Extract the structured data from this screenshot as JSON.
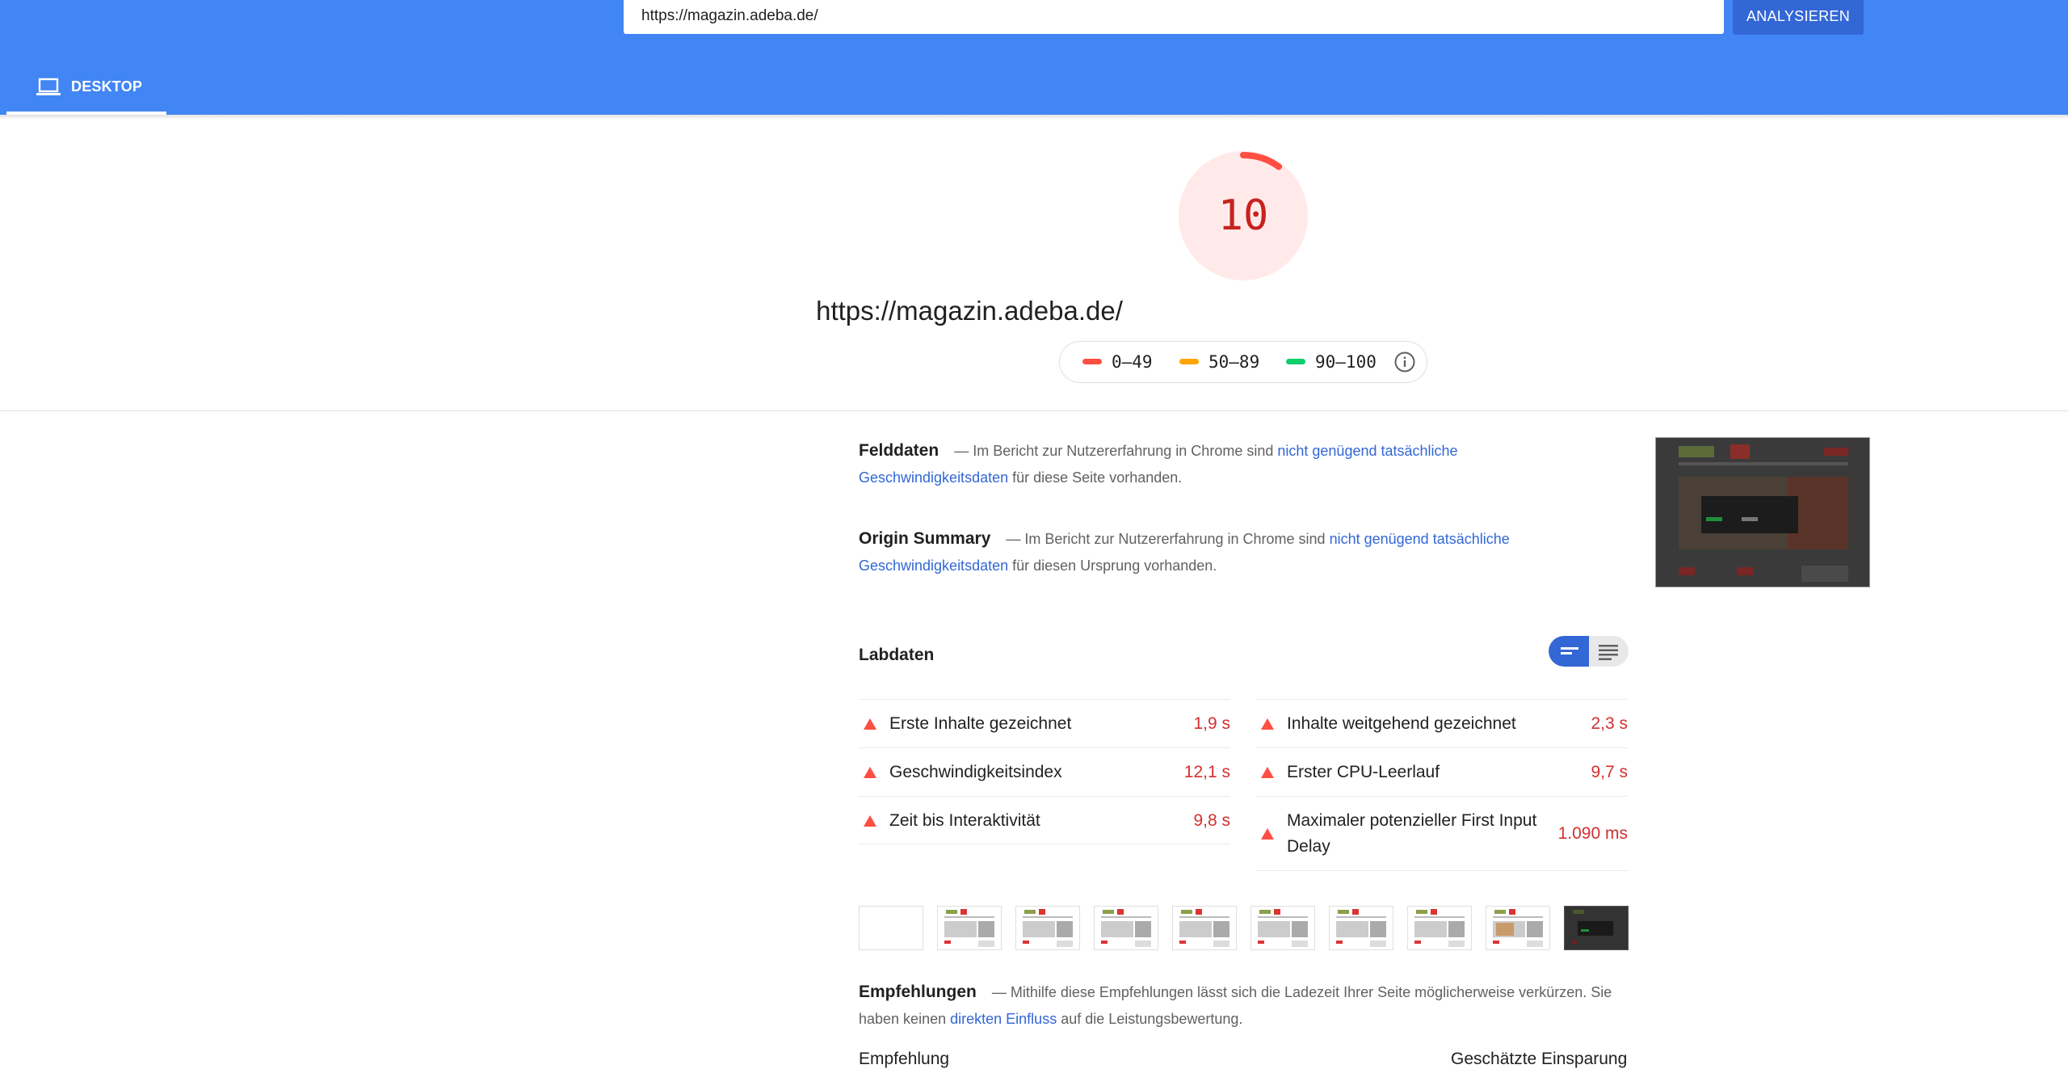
{
  "header": {
    "url_value": "https://magazin.adeba.de/",
    "analyze_label": "ANALYSIEREN",
    "tab_desktop": "DESKTOP"
  },
  "score": {
    "value": "10",
    "fraction": 0.1,
    "color": "#ff4e42",
    "bg_color": "#ffeae9"
  },
  "page_url": "https://magazin.adeba.de/",
  "legend": {
    "items": [
      {
        "label": "0–49",
        "color": "#ff4e42"
      },
      {
        "label": "50–89",
        "color": "#ffa400"
      },
      {
        "label": "90–100",
        "color": "#0cce6b"
      }
    ],
    "info_icon": "info-icon"
  },
  "field_data": {
    "title": "Felddaten",
    "pre": "— Im Bericht zur Nutzererfahrung in Chrome sind",
    "link": "nicht genügend tatsächliche Geschwindigkeitsdaten",
    "post": "für diese Seite vorhanden."
  },
  "origin_summary": {
    "title": "Origin Summary",
    "pre": "— Im Bericht zur Nutzererfahrung in Chrome sind",
    "link": "nicht genügend tatsächliche Geschwindigkeitsdaten",
    "post": "für diesen Ursprung vorhanden."
  },
  "lab_data": {
    "title": "Labdaten",
    "left": [
      {
        "name": "Erste Inhalte gezeichnet",
        "value": "1,9 s"
      },
      {
        "name": "Geschwindigkeitsindex",
        "value": "12,1 s"
      },
      {
        "name": "Zeit bis Interaktivität",
        "value": "9,8 s"
      }
    ],
    "right": [
      {
        "name": "Inhalte weitgehend gezeichnet",
        "value": "2,3 s"
      },
      {
        "name": "Erster CPU-Leerlauf",
        "value": "9,7 s"
      },
      {
        "name": "Maximaler potenzieller First Input Delay",
        "value": "1.090 ms"
      }
    ],
    "fail_color": "#ff4e42",
    "value_color": "#d32f2f"
  },
  "recommendations": {
    "title": "Empfehlungen",
    "pre": "— Mithilfe diese Empfehlungen lässt sich die Ladezeit Ihrer Seite möglicherweise verkürzen. Sie haben keinen",
    "link": "direkten Einfluss",
    "post": "auf die Leistungsbewertung.",
    "col_left": "Empfehlung",
    "col_right": "Geschätzte Einsparung"
  },
  "colors": {
    "header_blue": "#4285f4",
    "button_blue": "#3367d6",
    "link_blue": "#3367d6"
  }
}
